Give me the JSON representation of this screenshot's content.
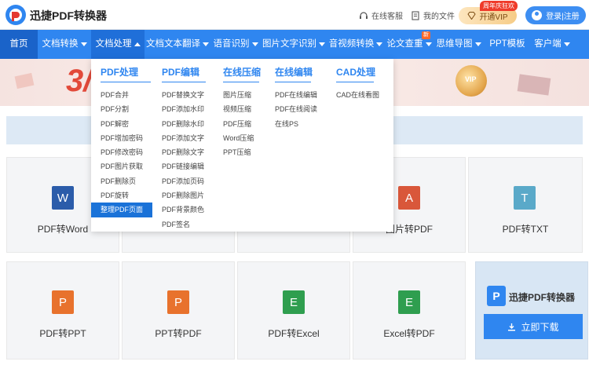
{
  "header": {
    "brand": "迅捷PDF转换器",
    "service_label": "在线客服",
    "files_label": "我的文件",
    "vip_tag": "周年庆狂欢",
    "vip_label": "开通VIP",
    "login_label": "登录|注册"
  },
  "nav": [
    {
      "label": "首页"
    },
    {
      "label": "文档转换"
    },
    {
      "label": "文档处理"
    },
    {
      "label": "文档文本翻译"
    },
    {
      "label": "语音识别"
    },
    {
      "label": "图片文字识别"
    },
    {
      "label": "音视频转换"
    },
    {
      "label": "论文查重",
      "badge": "新"
    },
    {
      "label": "思维导图"
    },
    {
      "label": "PPT模板"
    },
    {
      "label": "客户端"
    }
  ],
  "banner": {
    "big_text": "3/",
    "coin_text": "VIP"
  },
  "dropdown": {
    "columns": [
      {
        "title": "PDF处理",
        "items": [
          "PDF合并",
          "PDF分割",
          "PDF解密",
          "PDF增加密码",
          "PDF修改密码",
          "PDF图片获取",
          "PDF删除页",
          "PDF旋转",
          "整理PDF页面"
        ],
        "selected": 8
      },
      {
        "title": "PDF编辑",
        "items": [
          "PDF替换文字",
          "PDF添加水印",
          "PDF删除水印",
          "PDF添加文字",
          "PDF删除文字",
          "PDF链接编辑",
          "PDF添加页码",
          "PDF删除图片",
          "PDF背景颜色",
          "PDF签名"
        ]
      },
      {
        "title": "在线压缩",
        "items": [
          "图片压缩",
          "视频压缩",
          "PDF压缩",
          "Word压缩",
          "PPT压缩"
        ]
      },
      {
        "title": "在线编辑",
        "items": [
          "PDF在线编辑",
          "PDF在线阅读",
          "在线PS"
        ]
      },
      {
        "title": "CAD处理",
        "items": [
          "CAD在线看图"
        ]
      }
    ]
  },
  "tools": [
    {
      "label": "PDF转Word",
      "icon": "W",
      "color": "#2b5caa"
    },
    {
      "label": "",
      "icon": "",
      "color": "#f4f5f7"
    },
    {
      "label": "",
      "icon": "",
      "color": "#f4f5f7"
    },
    {
      "label": "图片转PDF",
      "icon": "A",
      "color": "#d9573a"
    },
    {
      "label": "PDF转TXT",
      "icon": "T",
      "color": "#5aa9c9"
    },
    {
      "label": "PDF转PPT",
      "icon": "P",
      "color": "#e8722d"
    },
    {
      "label": "PPT转PDF",
      "icon": "P",
      "color": "#e8722d"
    },
    {
      "label": "PDF转Excel",
      "icon": "E",
      "color": "#2f9e4f"
    },
    {
      "label": "Excel转PDF",
      "icon": "E",
      "color": "#2f9e4f"
    }
  ],
  "promo": {
    "name": "迅捷PDF转换器",
    "download_label": "立即下载"
  }
}
